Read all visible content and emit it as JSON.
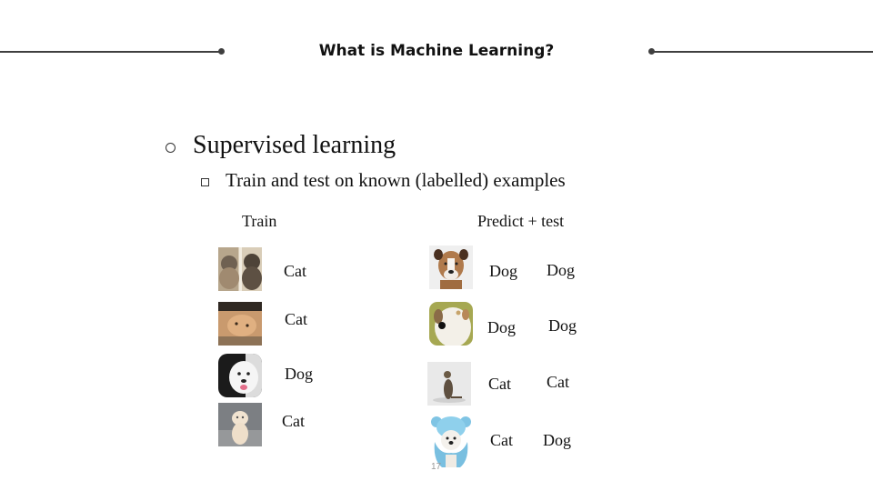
{
  "header": {
    "title": "What is Machine Learning?"
  },
  "content": {
    "bullet_level1": "Supervised learning",
    "bullet_level2": "Train and test on known (labelled) examples",
    "train_heading": "Train",
    "predict_heading": "Predict + test"
  },
  "train_examples": [
    {
      "image": "two-cats-photo",
      "label": "Cat"
    },
    {
      "image": "orange-cat-photo",
      "label": "Cat"
    },
    {
      "image": "white-puppy-photo",
      "label": "Dog"
    },
    {
      "image": "kitten-photo",
      "label": "Cat"
    }
  ],
  "test_examples": [
    {
      "image": "boxer-dog-photo",
      "prediction": "Dog",
      "truth": "Dog"
    },
    {
      "image": "white-dog-photo",
      "prediction": "Dog",
      "truth": "Dog"
    },
    {
      "image": "tabby-cat-photo",
      "prediction": "Cat",
      "truth": "Cat"
    },
    {
      "image": "dog-in-blue-hood-photo",
      "prediction": "Cat",
      "truth": "Dog"
    }
  ],
  "slide_number": "17",
  "colors": {
    "rule": "#3f3f3f",
    "text": "#111111"
  }
}
